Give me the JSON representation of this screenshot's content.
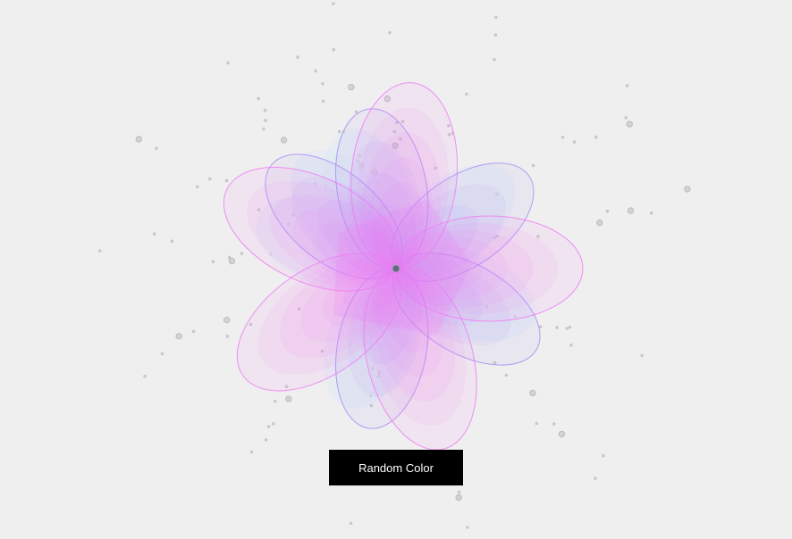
{
  "button": {
    "label": "Random Color"
  },
  "colors": {
    "background": "#efefef",
    "petal_pink": "#f07cf5",
    "petal_violet": "#a98cf7",
    "petal_light": "#dfe9f2",
    "center": "#666a80",
    "dots": "#b8b8b8",
    "button_bg": "#000000",
    "button_text": "#ffffff"
  }
}
